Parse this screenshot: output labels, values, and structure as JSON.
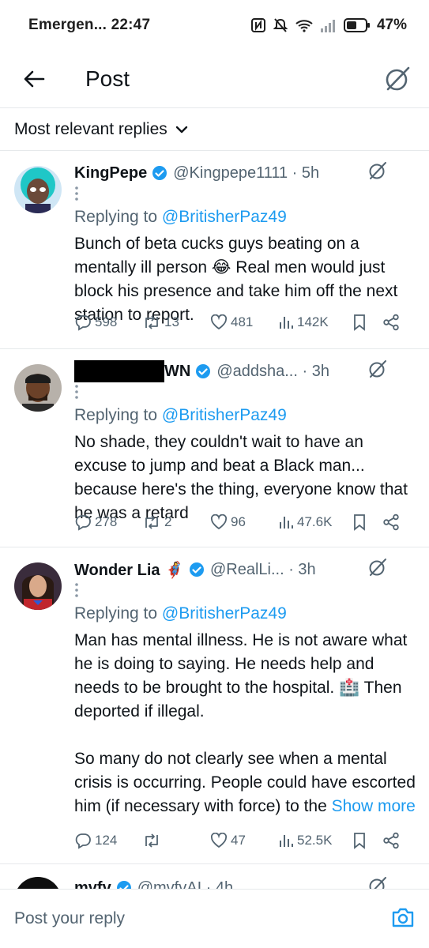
{
  "status_bar": {
    "carrier": "Emergen... 22:47",
    "battery": "47%"
  },
  "header": {
    "back_icon": "arrow-left-icon",
    "title": "Post",
    "grok_icon": "grok-icon"
  },
  "sort": {
    "label": "Most relevant replies"
  },
  "replies": [
    {
      "name": "KingPepe",
      "handle": "@Kingpepe1111 · 5h",
      "replying_prefix": "Replying to ",
      "replying_to": "@BritisherPaz49",
      "text": "Bunch of beta cucks guys beating on a mentally ill person 😂 Real men would just block his presence and take him off the next station to report.",
      "replies": "598",
      "reposts": "13",
      "likes": "481",
      "views": "142K"
    },
    {
      "name": "WN",
      "handle": "@addsha... · 3h",
      "replying_prefix": "Replying to ",
      "replying_to": "@BritisherPaz49",
      "text": "No shade, they couldn't wait to have an excuse to jump and beat a Black man... because here's the thing, everyone know that he was a retard",
      "replies": "278",
      "reposts": "2",
      "likes": "96",
      "views": "47.6K"
    },
    {
      "name": "Wonder Lia 🦸‍♀️",
      "handle": "@RealLi...  · 3h",
      "replying_prefix": "Replying to ",
      "replying_to": "@BritisherPaz49",
      "text": "Man has mental illness. He is not aware what he is doing to saying. He needs help and needs to be brought to the hospital. 🏥 Then deported if illegal.\n\nSo many do not clearly see when a mental crisis is occurring. People could have escorted him (if necessary with force) to the ",
      "show_more": "Show more",
      "replies": "124",
      "reposts": "",
      "likes": "47",
      "views": "52.5K"
    },
    {
      "name": "mvfv",
      "handle": "@mvfvAI · 4h"
    }
  ],
  "compose": {
    "placeholder": "Post your reply",
    "camera_icon": "camera-icon"
  },
  "colors": {
    "accent": "#1d9bf0",
    "verified": "#1d9bf0",
    "muted": "#536471",
    "text": "#0f1419"
  }
}
